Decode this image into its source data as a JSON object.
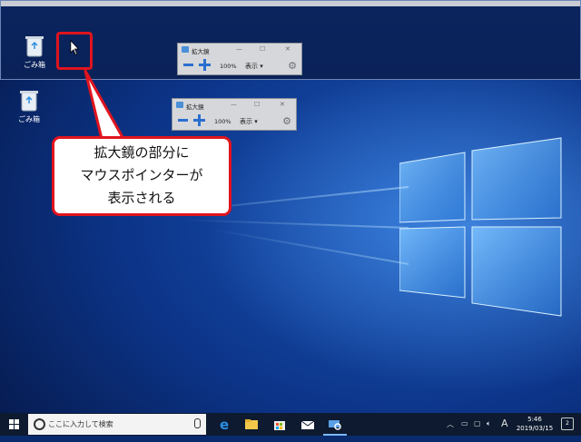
{
  "desktop": {
    "recycle_bin_label": "ごみ箱"
  },
  "magnifier": {
    "title": "拡大鏡",
    "zoom": "100%",
    "view_label": "表示 ▾",
    "minimize": "—",
    "maximize": "☐",
    "close": "✕"
  },
  "callout": {
    "line1": "拡大鏡の部分に",
    "line2": "マウスポインターが",
    "line3": "表示される"
  },
  "taskbar": {
    "search_placeholder": "ここに入力して検索",
    "ime": "A",
    "time": "5:46",
    "date": "2019/03/15",
    "notification_count": "2"
  },
  "colors": {
    "callout_border": "#e0141e",
    "taskbar": "#0d1a2f",
    "accent": "#2a6fcf"
  }
}
